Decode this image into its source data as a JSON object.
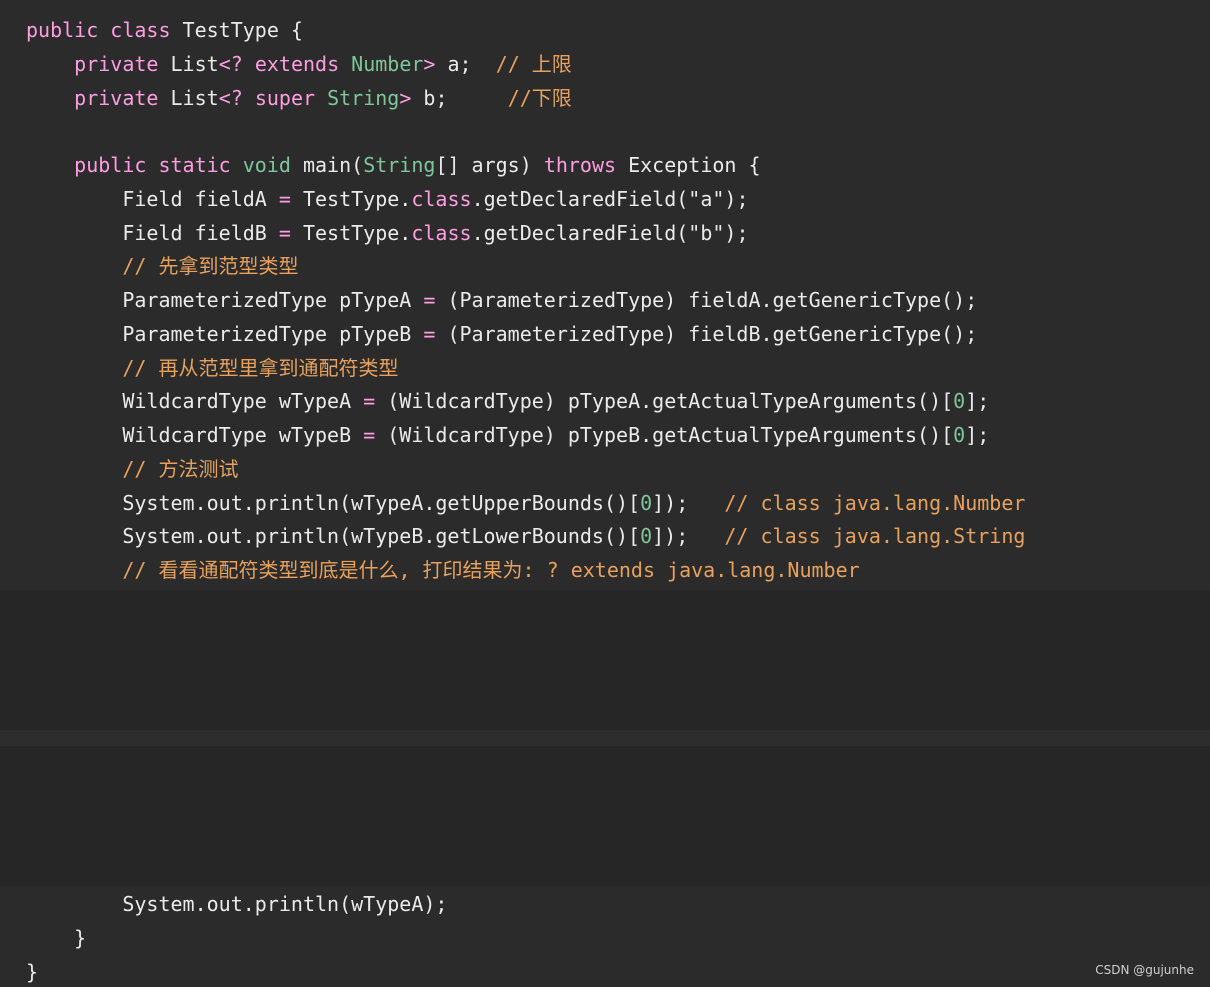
{
  "code": {
    "l1": [
      "public",
      " ",
      "class",
      " TestType {"
    ],
    "l2": [
      "private",
      " List",
      "<?",
      " ",
      "extends",
      " ",
      "Number",
      ">",
      " a;  ",
      "// 上限"
    ],
    "l3": [
      "private",
      " List",
      "<?",
      " ",
      "super",
      " ",
      "String",
      ">",
      " b;     ",
      "//下限"
    ],
    "l5": [
      "public",
      " ",
      "static",
      " ",
      "void",
      " main(",
      "String",
      "[] args) ",
      "throws",
      " Exception {"
    ],
    "l6": [
      "Field fieldA ",
      "=",
      " TestType.",
      "class",
      ".getDeclaredField(\"a\");"
    ],
    "l7": [
      "Field fieldB ",
      "=",
      " TestType.",
      "class",
      ".getDeclaredField(\"b\");"
    ],
    "l8": "// 先拿到范型类型",
    "l9": [
      "ParameterizedType pTypeA ",
      "=",
      " (ParameterizedType) fieldA.getGenericType();"
    ],
    "l10": [
      "ParameterizedType pTypeB ",
      "=",
      " (ParameterizedType) fieldB.getGenericType();"
    ],
    "l11": "// 再从范型里拿到通配符类型",
    "l12": [
      "WildcardType wTypeA ",
      "=",
      " (WildcardType) pTypeA.getActualTypeArguments()[",
      "0",
      "];"
    ],
    "l13": [
      "WildcardType wTypeB ",
      "=",
      " (WildcardType) pTypeB.getActualTypeArguments()[",
      "0",
      "];"
    ],
    "l14": "// 方法测试",
    "l15": [
      "System.out.println(wTypeA.getUpperBounds()[",
      "0",
      "]);   ",
      "// class java.lang.Number"
    ],
    "l16": [
      "System.out.println(wTypeB.getLowerBounds()[",
      "0",
      "]);   ",
      "// class java.lang.String"
    ],
    "l17": "// 看看通配符类型到底是什么, 打印结果为: ? extends java.lang.Number",
    "l18": "System.out.println(wTypeA);",
    "l19": "}",
    "l20": "}"
  },
  "watermark": "CSDN @gujunhe"
}
